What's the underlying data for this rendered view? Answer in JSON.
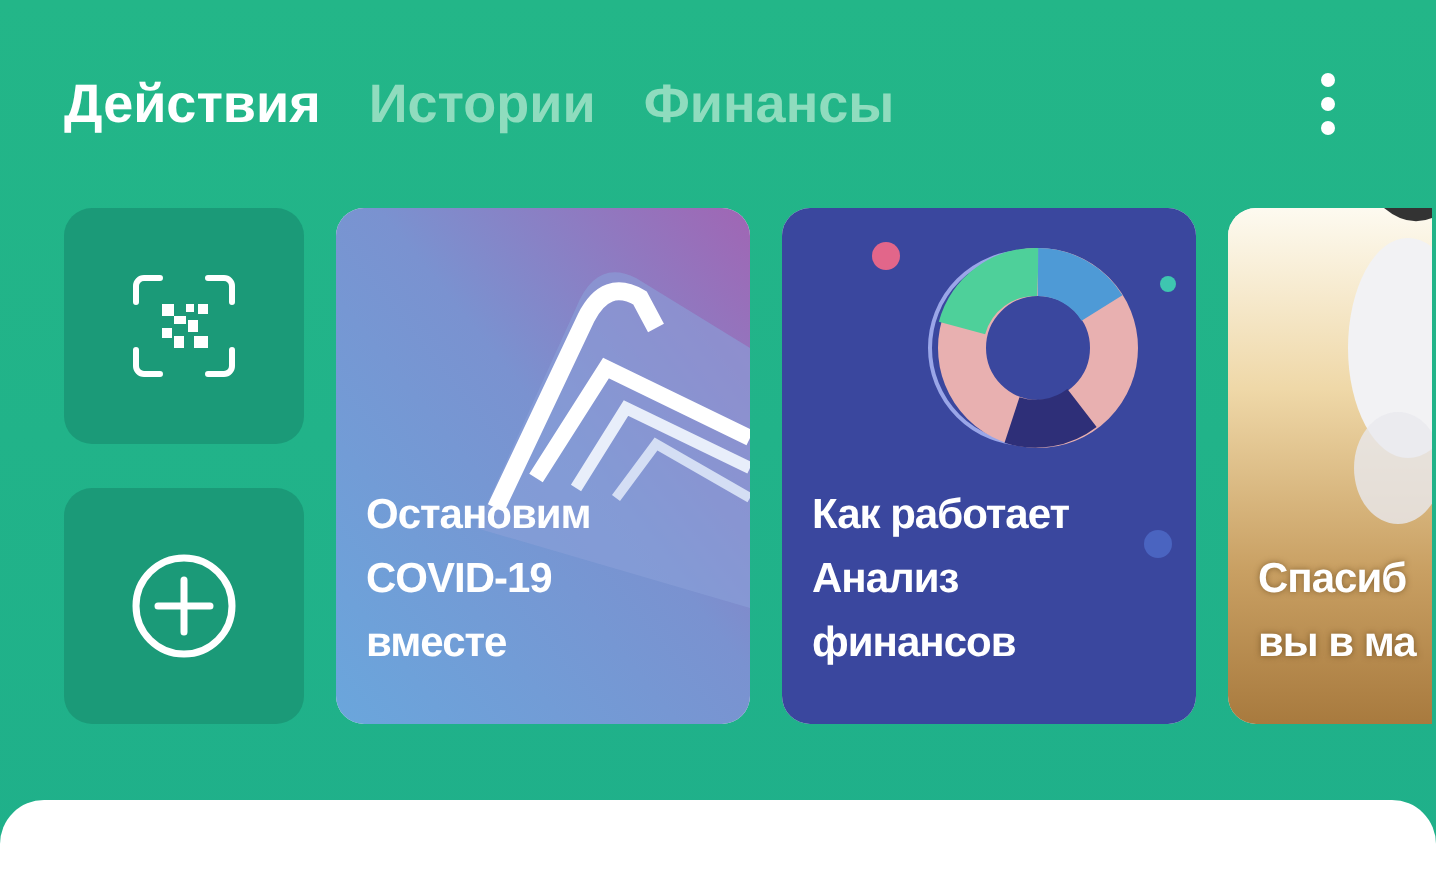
{
  "tabs": [
    {
      "label": "Действия",
      "selected": true
    },
    {
      "label": "Истории",
      "selected": false
    },
    {
      "label": "Финансы",
      "selected": false
    }
  ],
  "actions": [
    {
      "kind": "scan"
    },
    {
      "kind": "add"
    }
  ],
  "stories": [
    {
      "kind": "covid",
      "text": "Остановим\nCOVID-19\nвместе"
    },
    {
      "kind": "finance",
      "text": "Как работает\nАнализ\nфинансов"
    },
    {
      "kind": "thanks",
      "text": "Спасиб\nвы в ма"
    }
  ]
}
